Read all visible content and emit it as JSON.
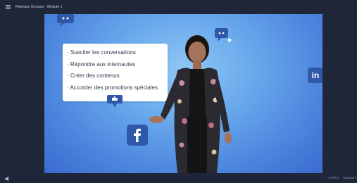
{
  "header": {
    "title": "Réseaux Sociaux - Module 1"
  },
  "content": {
    "bullets": [
      "Susciter les conversations",
      "Répondre aux internautes",
      "Créer des contenus",
      "Accorder des promotions spéciales"
    ],
    "linkedin_text": "in"
  },
  "footer": {
    "prev_label": "< PRÉC.",
    "next_label": "SUIVANT"
  },
  "icons": {
    "menu": "menu-icon",
    "facebook": "facebook-icon",
    "linkedin": "linkedin-icon",
    "chat": "chat-bubble-icon",
    "thumbs_up": "thumbs-up-icon",
    "sound": "speaker-icon"
  },
  "colors": {
    "background": "#1e2638",
    "brand_icon": "#2f58a8",
    "card": "#ffffff"
  }
}
